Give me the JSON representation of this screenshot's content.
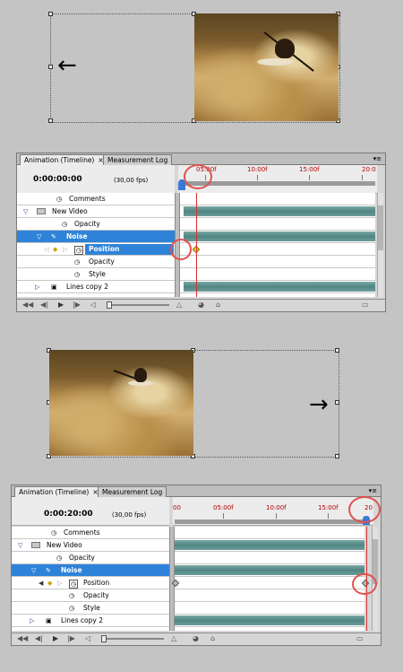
{
  "canvas_top": {
    "arrow": "←"
  },
  "canvas_bottom": {
    "arrow": "→"
  },
  "panel_top": {
    "tabs": [
      {
        "label": "Animation (Timeline)",
        "close": "×"
      },
      {
        "label": "Measurement Log"
      }
    ],
    "timecode": "0:00:00:00",
    "fps": "(30,00 fps)",
    "ruler_labels": [
      "05:00f",
      "10:00f",
      "15:00f",
      "20:0"
    ],
    "layers": [
      {
        "label": "Comments"
      },
      {
        "label": "New Video"
      },
      {
        "label": "Opacity"
      },
      {
        "label": "Noise"
      },
      {
        "label": "Position"
      },
      {
        "label": "Opacity"
      },
      {
        "label": "Style"
      },
      {
        "label": "Lines copy 2"
      }
    ]
  },
  "panel_bottom": {
    "tabs": [
      {
        "label": "Animation (Timeline)",
        "close": "×"
      },
      {
        "label": "Measurement Log"
      }
    ],
    "timecode": "0:00:20:00",
    "fps": "(30,00 fps)",
    "ruler_labels": [
      "00",
      "05:00f",
      "10:00f",
      "15:00f",
      "20"
    ],
    "layers": [
      {
        "label": "Comments"
      },
      {
        "label": "New Video"
      },
      {
        "label": "Opacity"
      },
      {
        "label": "Noise"
      },
      {
        "label": "Position"
      },
      {
        "label": "Opacity"
      },
      {
        "label": "Style"
      },
      {
        "label": "Lines copy 2"
      }
    ]
  },
  "colors": {
    "selection": "#2e83d9",
    "playhead": "#d63030",
    "track": "#4f8581",
    "highlight_circle": "#e25050",
    "keyframe": "#ffd200"
  },
  "icons": [
    "stopwatch-icon",
    "folder-icon",
    "brush-icon",
    "twirl-triangle-icon",
    "keyframe-icon",
    "play-icon",
    "step-back-icon",
    "step-forward-icon",
    "first-frame-icon",
    "trash-icon",
    "tween-icon"
  ]
}
